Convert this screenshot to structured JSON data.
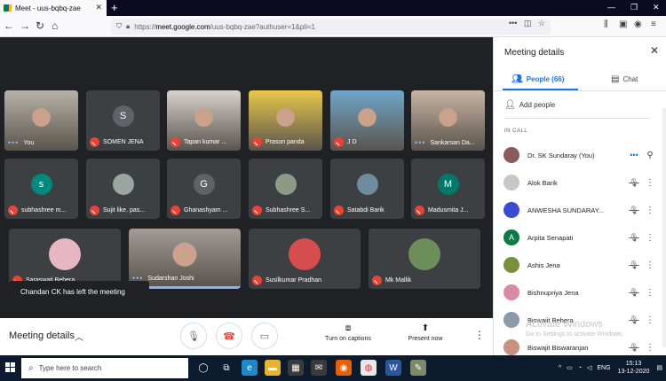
{
  "browser": {
    "tab_title": "Meet - uus-bqbq-zae",
    "new_tab": "+",
    "url_domain": "meet.google.com",
    "url_prefix": "https://",
    "url_suffix": "/uus-bqbq-zae?authuser=1&pli=1"
  },
  "tiles": [
    {
      "name": "You",
      "state": "speaking",
      "bg": "#b9b2a8"
    },
    {
      "name": "SOMEN JENA",
      "state": "muted",
      "avatar": "S",
      "avatar_color": "#5f6368"
    },
    {
      "name": "Tapan kumar ...",
      "state": "muted",
      "bg": "#d8d2cc"
    },
    {
      "name": "Prasun panda",
      "state": "muted",
      "bg": "#e8c84a"
    },
    {
      "name": "J D",
      "state": "muted",
      "bg": "#6fa6c9"
    },
    {
      "name": "Sankarsan Da...",
      "state": "speaking",
      "bg": "#c9b4a2"
    },
    {
      "name": "subhashree m...",
      "state": "muted",
      "avatar": "s",
      "avatar_color": "#00897b"
    },
    {
      "name": "Sujit like. pas...",
      "state": "muted",
      "avatar_color": "#9aa6a0"
    },
    {
      "name": "Ghanashyam ...",
      "state": "muted",
      "avatar": "G",
      "avatar_color": "#5f6368"
    },
    {
      "name": "Subhashree S...",
      "state": "muted",
      "avatar_color": "#8d9b86"
    },
    {
      "name": "Satabdi Barik",
      "state": "muted",
      "avatar_color": "#6d8c9c"
    },
    {
      "name": "Madusmita J...",
      "state": "muted",
      "avatar": "M",
      "avatar_color": "#00796b"
    },
    {
      "name": "Saraswati Behera",
      "state": "muted",
      "avatar_color": "#e7b6c4"
    },
    {
      "name": "Sudarshan Joshi",
      "state": "speaking",
      "bg": "#a39c96"
    },
    {
      "name": "Susilkumar Pradhan",
      "state": "muted",
      "avatar_color": "#d64d4d"
    },
    {
      "name": "Mk Mallik",
      "state": "muted",
      "avatar_color": "#6b8e5a"
    }
  ],
  "toast": "Chandan CK has left the meeting",
  "bottom_bar": {
    "meeting_details": "Meeting details",
    "captions_label": "Turn on captions",
    "present_label": "Present now"
  },
  "sidebar": {
    "title": "Meeting details",
    "tab_people": "People (66)",
    "tab_chat": "Chat",
    "add_people": "Add people",
    "in_call": "IN CALL",
    "people": [
      {
        "name": "Dr. SK Sundaray (You)",
        "avatar_color": "#8b5a5a",
        "you": true
      },
      {
        "name": "Alok Barik",
        "avatar_color": "#c5c9c0"
      },
      {
        "name": "ANWESHA SUNDARAY...",
        "avatar_color": "#3b4bd1"
      },
      {
        "name": "Arpita Senapati",
        "initial": "A",
        "avatar_color": "#0b7a43"
      },
      {
        "name": "Ashis Jena",
        "avatar_color": "#7a8f3a"
      },
      {
        "name": "Bishnupriya Jena",
        "avatar_color": "#d98aa5"
      },
      {
        "name": "Biswajit Behera",
        "avatar_color": "#8a9aa8"
      },
      {
        "name": "Biswajit Biswaranjan",
        "avatar_color": "#c89080"
      }
    ]
  },
  "watermark": {
    "line1": "Activate Windows",
    "line2": "Go to Settings to activate Windows."
  },
  "taskbar": {
    "search_placeholder": "Type here to search",
    "lang": "ENG",
    "time": "15:13",
    "date": "13-12-2020"
  }
}
